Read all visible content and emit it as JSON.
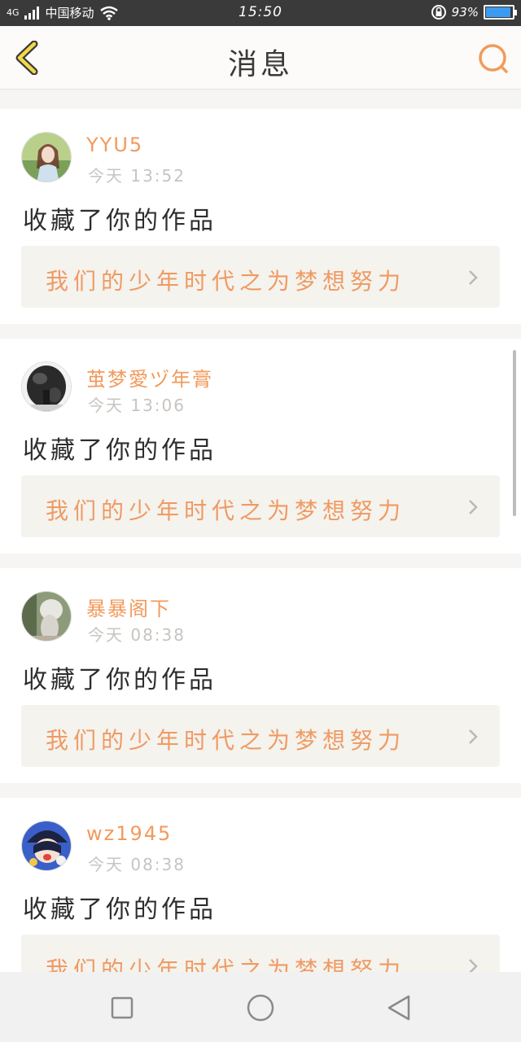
{
  "status_bar": {
    "network": "4G",
    "carrier": "中国移动",
    "time": "15:50",
    "battery_text": "93%",
    "battery_level": 0.93
  },
  "header": {
    "title": "消息",
    "accent_color": "#f29a5c"
  },
  "notifications": [
    {
      "username": "YYU5",
      "time": "今天 13:52",
      "action": "收藏了你的作品",
      "work_title": "我们的少年时代之为梦想努力"
    },
    {
      "username": "茧梦愛ヅ年膏",
      "time": "今天 13:06",
      "action": "收藏了你的作品",
      "work_title": "我们的少年时代之为梦想努力"
    },
    {
      "username": "暴暴阁下",
      "time": "今天 08:38",
      "action": "收藏了你的作品",
      "work_title": "我们的少年时代之为梦想努力"
    },
    {
      "username": "wz1945",
      "time": "今天 08:38",
      "action": "收藏了你的作品",
      "work_title": "我们的少年时代之为梦想努力"
    }
  ],
  "icons": {
    "back": "chevron-left-icon",
    "search": "search-icon",
    "nav_recent": "square-icon",
    "nav_home": "circle-icon",
    "nav_back": "triangle-back-icon"
  }
}
